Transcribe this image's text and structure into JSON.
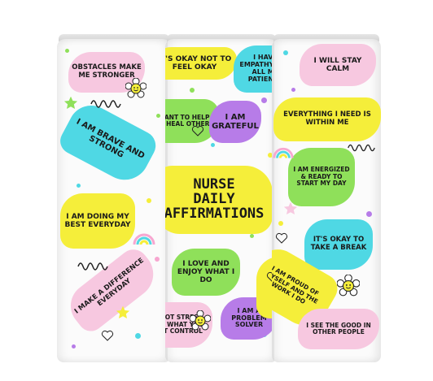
{
  "title_lines": [
    "NURSE",
    "DAILY",
    "AFFIRMATIONS"
  ],
  "affirmations": {
    "obstacles": "OBSTACLES MAKE ME STRONGER",
    "okay_not_ok": "IT'S OKAY NOT TO FEEL OKAY",
    "empathy": "I HAVE EMPATHY FOR ALL MY PATIENTS",
    "stay_calm": "I WILL STAY CALM",
    "help_heal": "I WANT TO HELP AND HEAL OTHERS",
    "grateful": "I AM GRATEFUL",
    "within_me": "EVERYTHING I NEED IS WITHIN ME",
    "brave": "I AM BRAVE AND STRONG",
    "energized": "I AM ENERGIZED & READY TO START MY DAY",
    "doing_best": "I AM DOING MY BEST EVERYDAY",
    "take_break": "IT'S OKAY TO TAKE A BREAK",
    "love_job": "I LOVE AND ENJOY WHAT I DO",
    "difference": "I MAKE A DIFFERENCE EVERYDAY",
    "proud": "I AM PROUD OF MYSELF AND THE WORK I DO",
    "dont_stress": "DO NOT STRESS OVER WHAT YOU CAN'T CONTROL",
    "problem_solver": "I AM A PROBLEM SOLVER",
    "see_good": "I SEE THE GOOD IN OTHER PEOPLE"
  },
  "colors": {
    "yellow": "#f5ee3a",
    "pink": "#f7c8e0",
    "cyan": "#4fd8e4",
    "green": "#8fe05a",
    "purple": "#b77ce8",
    "white_tumbler": "#fbfbfb"
  },
  "icons": [
    "smiley-daisy-icon",
    "rainbow-icon",
    "heart-outline-icon",
    "star-icon",
    "squiggle-icon"
  ]
}
